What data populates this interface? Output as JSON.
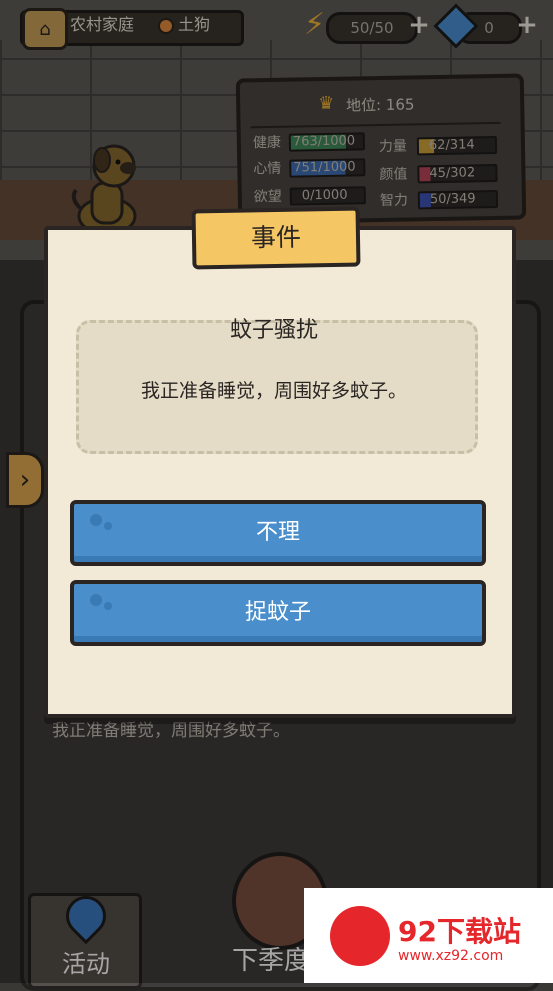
{
  "topbar": {
    "home_label": "农村家庭",
    "rank_label": "土狗",
    "energy": "50/50",
    "gems": "0"
  },
  "status": {
    "title": "地位: 165",
    "stats": [
      {
        "label": "健康",
        "value": "763/1000",
        "fill": 0.763,
        "color": "#3f8a5a"
      },
      {
        "label": "心情",
        "value": "751/1000",
        "fill": 0.751,
        "color": "#3f6fb4"
      },
      {
        "label": "欲望",
        "value": "0/1000",
        "fill": 0.0,
        "color": "#888888"
      },
      {
        "label": "力量",
        "value": "62/314",
        "fill": 0.197,
        "color": "#d2a43c"
      },
      {
        "label": "颜值",
        "value": "45/302",
        "fill": 0.149,
        "color": "#b8475a"
      },
      {
        "label": "智力",
        "value": "50/349",
        "fill": 0.143,
        "color": "#3e54b4"
      }
    ]
  },
  "dialog": {
    "tag": "事件",
    "title": "蚊子骚扰",
    "description": "我正准备睡觉，周围好多蚊子。",
    "choices": [
      "不理",
      "捉蚊子"
    ]
  },
  "background_text": "我正准备睡觉，周围好多蚊子。",
  "bottom": {
    "activity": "活动",
    "season": "下季度"
  },
  "watermark": {
    "title": "92下载站",
    "url": "www.xz92.com"
  },
  "colors": {
    "button_blue": "#4a8fcc",
    "tag_yellow": "#f4c664",
    "paper": "#f2ead6",
    "brand_red": "#e5262b"
  }
}
